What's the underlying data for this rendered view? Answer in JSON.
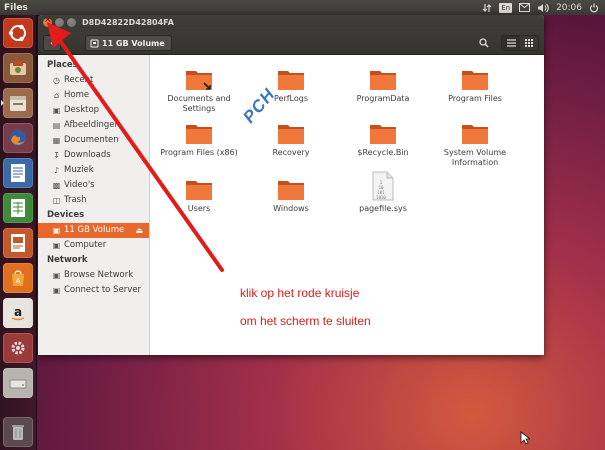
{
  "panel": {
    "app_name": "Files",
    "keyboard_layout": "En",
    "clock": "20:06",
    "icons": [
      "transfer-icon",
      "keyboard-layout-icon",
      "mail-icon",
      "volume-icon",
      "clock",
      "power-icon"
    ]
  },
  "launcher": {
    "items": [
      "ubuntu-dash",
      "system-installer",
      "files",
      "firefox",
      "libreoffice-writer",
      "libreoffice-calc",
      "libreoffice-impress",
      "ubuntu-software-center",
      "amazon",
      "system-settings",
      "disk-drive",
      "trash"
    ]
  },
  "window": {
    "title": "D8D42822D42804FA",
    "path_label": "11 GB Volume",
    "buttons": [
      "close",
      "minimize",
      "maximize",
      "back",
      "search",
      "list-view",
      "grid-view"
    ]
  },
  "sidebar": {
    "places_heading": "Places",
    "places": [
      "Recent",
      "Home",
      "Desktop",
      "Afbeeldingen",
      "Documenten",
      "Downloads",
      "Muziek",
      "Video's",
      "Trash"
    ],
    "devices_heading": "Devices",
    "devices": [
      "11 GB Volume",
      "Computer"
    ],
    "network_heading": "Network",
    "network": [
      "Browse Network",
      "Connect to Server"
    ]
  },
  "files": [
    {
      "name_line1": "Documents and",
      "name_line2": "Settings",
      "type": "folder-link"
    },
    {
      "name_line1": "PerfLogs",
      "name_line2": "",
      "type": "folder"
    },
    {
      "name_line1": "ProgramData",
      "name_line2": "",
      "type": "folder"
    },
    {
      "name_line1": "Program Files",
      "name_line2": "",
      "type": "folder"
    },
    {
      "name_line1": "Program Files (x86)",
      "name_line2": "",
      "type": "folder"
    },
    {
      "name_line1": "Recovery",
      "name_line2": "",
      "type": "folder"
    },
    {
      "name_line1": "$Recycle.Bin",
      "name_line2": "",
      "type": "folder"
    },
    {
      "name_line1": "System Volume",
      "name_line2": "Information",
      "type": "folder"
    },
    {
      "name_line1": "Users",
      "name_line2": "",
      "type": "folder"
    },
    {
      "name_line1": "Windows",
      "name_line2": "",
      "type": "folder"
    },
    {
      "name_line1": "pagefile.sys",
      "name_line2": "",
      "type": "file"
    }
  ],
  "annotation": {
    "watermark": "PCH",
    "line1": "klik op het rode kruisje",
    "line2": "om het scherm te sluiten",
    "color": "#d81c1c"
  },
  "colors": {
    "accent": "#e8672d",
    "folder": "#e8672d",
    "close_button": "#df4a16",
    "panel": "#3a3935"
  }
}
